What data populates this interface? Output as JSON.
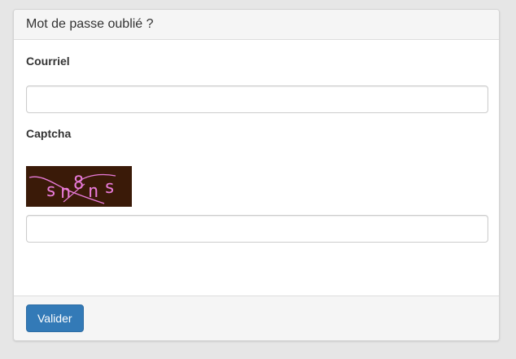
{
  "panel": {
    "title": "Mot de passe oublié ?"
  },
  "form": {
    "email_label": "Courriel",
    "email_value": "",
    "captcha_label": "Captcha",
    "captcha_text": "sn8ns",
    "captcha_value": ""
  },
  "footer": {
    "submit_label": "Valider"
  },
  "colors": {
    "primary": "#337ab7",
    "captcha_background": "#3a1a08",
    "captcha_text": "#e87ad8"
  }
}
